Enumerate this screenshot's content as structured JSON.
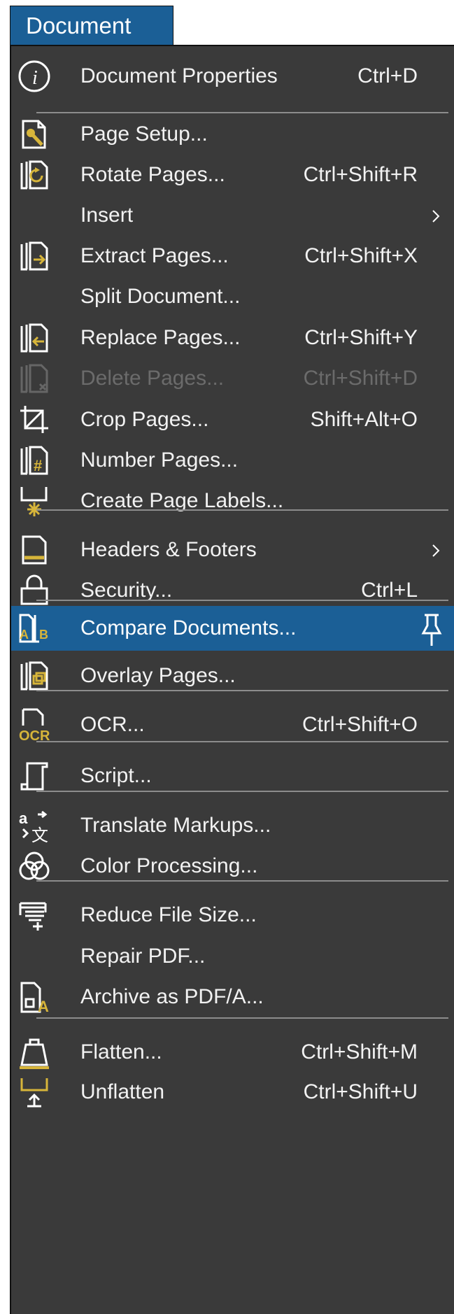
{
  "menu": {
    "title": "Document",
    "accent_color": "#1b5f96",
    "background_color": "#3a3a3a",
    "items": [
      {
        "label": "Document Properties",
        "shortcut": "Ctrl+D",
        "icon": "info-icon",
        "enabled": true
      },
      {
        "label": "Page Setup...",
        "shortcut": "",
        "icon": "page-setup-icon",
        "enabled": true
      },
      {
        "label": "Rotate Pages...",
        "shortcut": "Ctrl+Shift+R",
        "icon": "rotate-pages-icon",
        "enabled": true
      },
      {
        "label": "Insert",
        "shortcut": "",
        "icon": "",
        "submenu": true,
        "enabled": true
      },
      {
        "label": "Extract Pages...",
        "shortcut": "Ctrl+Shift+X",
        "icon": "extract-pages-icon",
        "enabled": true
      },
      {
        "label": "Split Document...",
        "shortcut": "",
        "icon": "",
        "enabled": true
      },
      {
        "label": "Replace Pages...",
        "shortcut": "Ctrl+Shift+Y",
        "icon": "replace-pages-icon",
        "enabled": true
      },
      {
        "label": "Delete Pages...",
        "shortcut": "Ctrl+Shift+D",
        "icon": "delete-pages-icon",
        "enabled": false
      },
      {
        "label": "Crop Pages...",
        "shortcut": "Shift+Alt+O",
        "icon": "crop-icon",
        "enabled": true
      },
      {
        "label": "Number Pages...",
        "shortcut": "",
        "icon": "number-pages-icon",
        "enabled": true
      },
      {
        "label": "Create Page Labels...",
        "shortcut": "",
        "icon": "page-labels-icon",
        "enabled": true
      },
      {
        "label": "Headers & Footers",
        "shortcut": "",
        "icon": "headers-footers-icon",
        "submenu": true,
        "enabled": true
      },
      {
        "label": "Security...",
        "shortcut": "Ctrl+L",
        "icon": "lock-icon",
        "enabled": true
      },
      {
        "label": "Compare Documents...",
        "shortcut": "",
        "icon": "compare-documents-icon",
        "pinned": true,
        "selected": true,
        "enabled": true
      },
      {
        "label": "Overlay Pages...",
        "shortcut": "",
        "icon": "overlay-pages-icon",
        "enabled": true
      },
      {
        "label": "OCR...",
        "shortcut": "Ctrl+Shift+O",
        "icon": "ocr-icon",
        "enabled": true
      },
      {
        "label": "Script...",
        "shortcut": "",
        "icon": "script-icon",
        "enabled": true
      },
      {
        "label": "Translate Markups...",
        "shortcut": "",
        "icon": "translate-icon",
        "enabled": true
      },
      {
        "label": "Color Processing...",
        "shortcut": "",
        "icon": "color-processing-icon",
        "enabled": true
      },
      {
        "label": "Reduce File Size...",
        "shortcut": "",
        "icon": "reduce-file-size-icon",
        "enabled": true
      },
      {
        "label": "Repair PDF...",
        "shortcut": "",
        "icon": "",
        "enabled": true
      },
      {
        "label": "Archive as PDF/A...",
        "shortcut": "",
        "icon": "archive-pdfa-icon",
        "enabled": true
      },
      {
        "label": "Flatten...",
        "shortcut": "Ctrl+Shift+M",
        "icon": "flatten-icon",
        "enabled": true
      },
      {
        "label": "Unflatten",
        "shortcut": "Ctrl+Shift+U",
        "icon": "unflatten-icon",
        "enabled": true
      }
    ]
  }
}
